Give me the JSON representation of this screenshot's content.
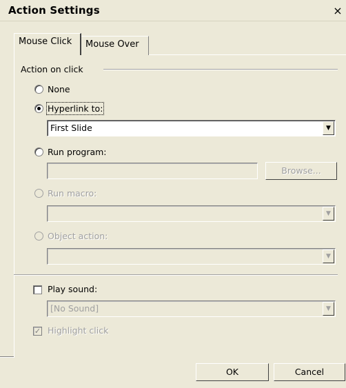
{
  "window": {
    "title": "Action Settings",
    "close_symbol": "×"
  },
  "tabs": [
    {
      "label": "Mouse Click",
      "active": true
    },
    {
      "label": "Mouse Over",
      "active": false
    }
  ],
  "group": {
    "label": "Action on click"
  },
  "options": {
    "none": {
      "label": "None",
      "checked": false,
      "enabled": true
    },
    "hyperlink": {
      "label": "Hyperlink to:",
      "checked": true,
      "enabled": true,
      "value": "First Slide"
    },
    "run_program": {
      "label": "Run program:",
      "checked": false,
      "enabled": true,
      "value": "",
      "browse_label": "Browse..."
    },
    "run_macro": {
      "label": "Run macro:",
      "checked": false,
      "enabled": false,
      "value": ""
    },
    "object_action": {
      "label": "Object action:",
      "checked": false,
      "enabled": false,
      "value": ""
    }
  },
  "play_sound": {
    "label": "Play sound:",
    "checked": false,
    "value": "[No Sound]"
  },
  "highlight_click": {
    "label": "Highlight click",
    "checked": true,
    "enabled": false
  },
  "buttons": {
    "ok": "OK",
    "cancel": "Cancel"
  }
}
